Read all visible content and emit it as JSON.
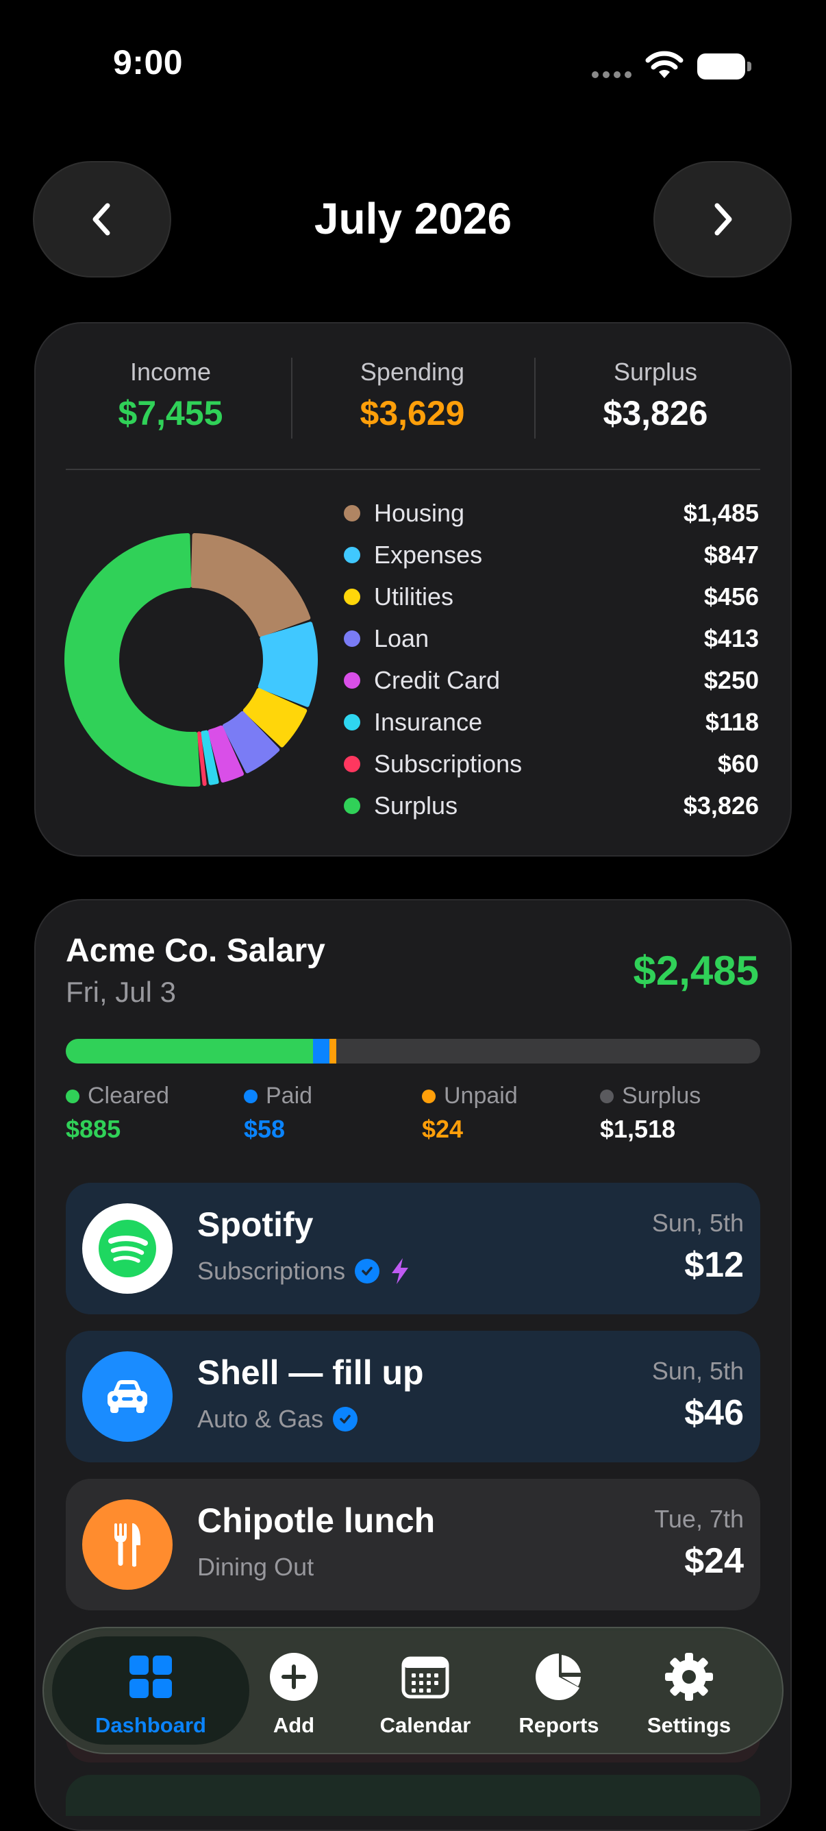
{
  "status_bar": {
    "time": "9:00"
  },
  "header": {
    "month": "July 2026",
    "prev_icon": "chevron-left-icon",
    "next_icon": "chevron-right-icon"
  },
  "summary": {
    "income": {
      "label": "Income",
      "value": "$7,455",
      "color": "#30d158"
    },
    "spending": {
      "label": "Spending",
      "value": "$3,629",
      "color": "#ff9f0a"
    },
    "surplus": {
      "label": "Surplus",
      "value": "$3,826",
      "color": "#ffffff"
    }
  },
  "categories": [
    {
      "label": "Housing",
      "value": "$1,485",
      "amount": 1485,
      "color": "#b08563"
    },
    {
      "label": "Expenses",
      "value": "$847",
      "amount": 847,
      "color": "#40c8ff"
    },
    {
      "label": "Utilities",
      "value": "$456",
      "amount": 456,
      "color": "#ffd60a"
    },
    {
      "label": "Loan",
      "value": "$413",
      "amount": 413,
      "color": "#7a7cf5"
    },
    {
      "label": "Credit Card",
      "value": "$250",
      "amount": 250,
      "color": "#d94fe8"
    },
    {
      "label": "Insurance",
      "value": "$118",
      "amount": 118,
      "color": "#2fd6f0"
    },
    {
      "label": "Subscriptions",
      "value": "$60",
      "amount": 60,
      "color": "#ff375f"
    },
    {
      "label": "Surplus",
      "value": "$3,826",
      "amount": 3826,
      "color": "#30d158"
    }
  ],
  "paycheck": {
    "title": "Acme Co. Salary",
    "date": "Fri, Jul 3",
    "amount": "$2,485",
    "progress": [
      {
        "label": "Cleared",
        "value": "$885",
        "amount": 885,
        "color": "#30d158"
      },
      {
        "label": "Paid",
        "value": "$58",
        "amount": 58,
        "color": "#0a84ff"
      },
      {
        "label": "Unpaid",
        "value": "$24",
        "amount": 24,
        "color": "#ff9f0a"
      },
      {
        "label": "Surplus",
        "value": "$1,518",
        "amount": 1518,
        "color": "#ffffff",
        "dot_color": "#5a5a5e"
      }
    ]
  },
  "transactions": [
    {
      "name": "Spotify",
      "category": "Subscriptions",
      "date": "Sun, 5th",
      "amount": "$12",
      "icon": "spotify-icon",
      "status": "paid",
      "autopay": true
    },
    {
      "name": "Shell — fill up",
      "category": "Auto & Gas",
      "date": "Sun, 5th",
      "amount": "$46",
      "icon": "car-icon",
      "status": "paid",
      "autopay": false
    },
    {
      "name": "Chipotle lunch",
      "category": "Dining Out",
      "date": "Tue, 7th",
      "amount": "$24",
      "icon": "fork-knife-icon",
      "status": "unpaid",
      "autopay": false
    }
  ],
  "tabbar": {
    "active": "dashboard",
    "tabs": [
      {
        "id": "dashboard",
        "label": "Dashboard",
        "icon": "grid-icon"
      },
      {
        "id": "add",
        "label": "Add",
        "icon": "plus-circle-icon"
      },
      {
        "id": "calendar",
        "label": "Calendar",
        "icon": "calendar-icon"
      },
      {
        "id": "reports",
        "label": "Reports",
        "icon": "pie-chart-icon"
      },
      {
        "id": "settings",
        "label": "Settings",
        "icon": "gear-icon"
      }
    ],
    "active_color": "#0a84ff"
  }
}
